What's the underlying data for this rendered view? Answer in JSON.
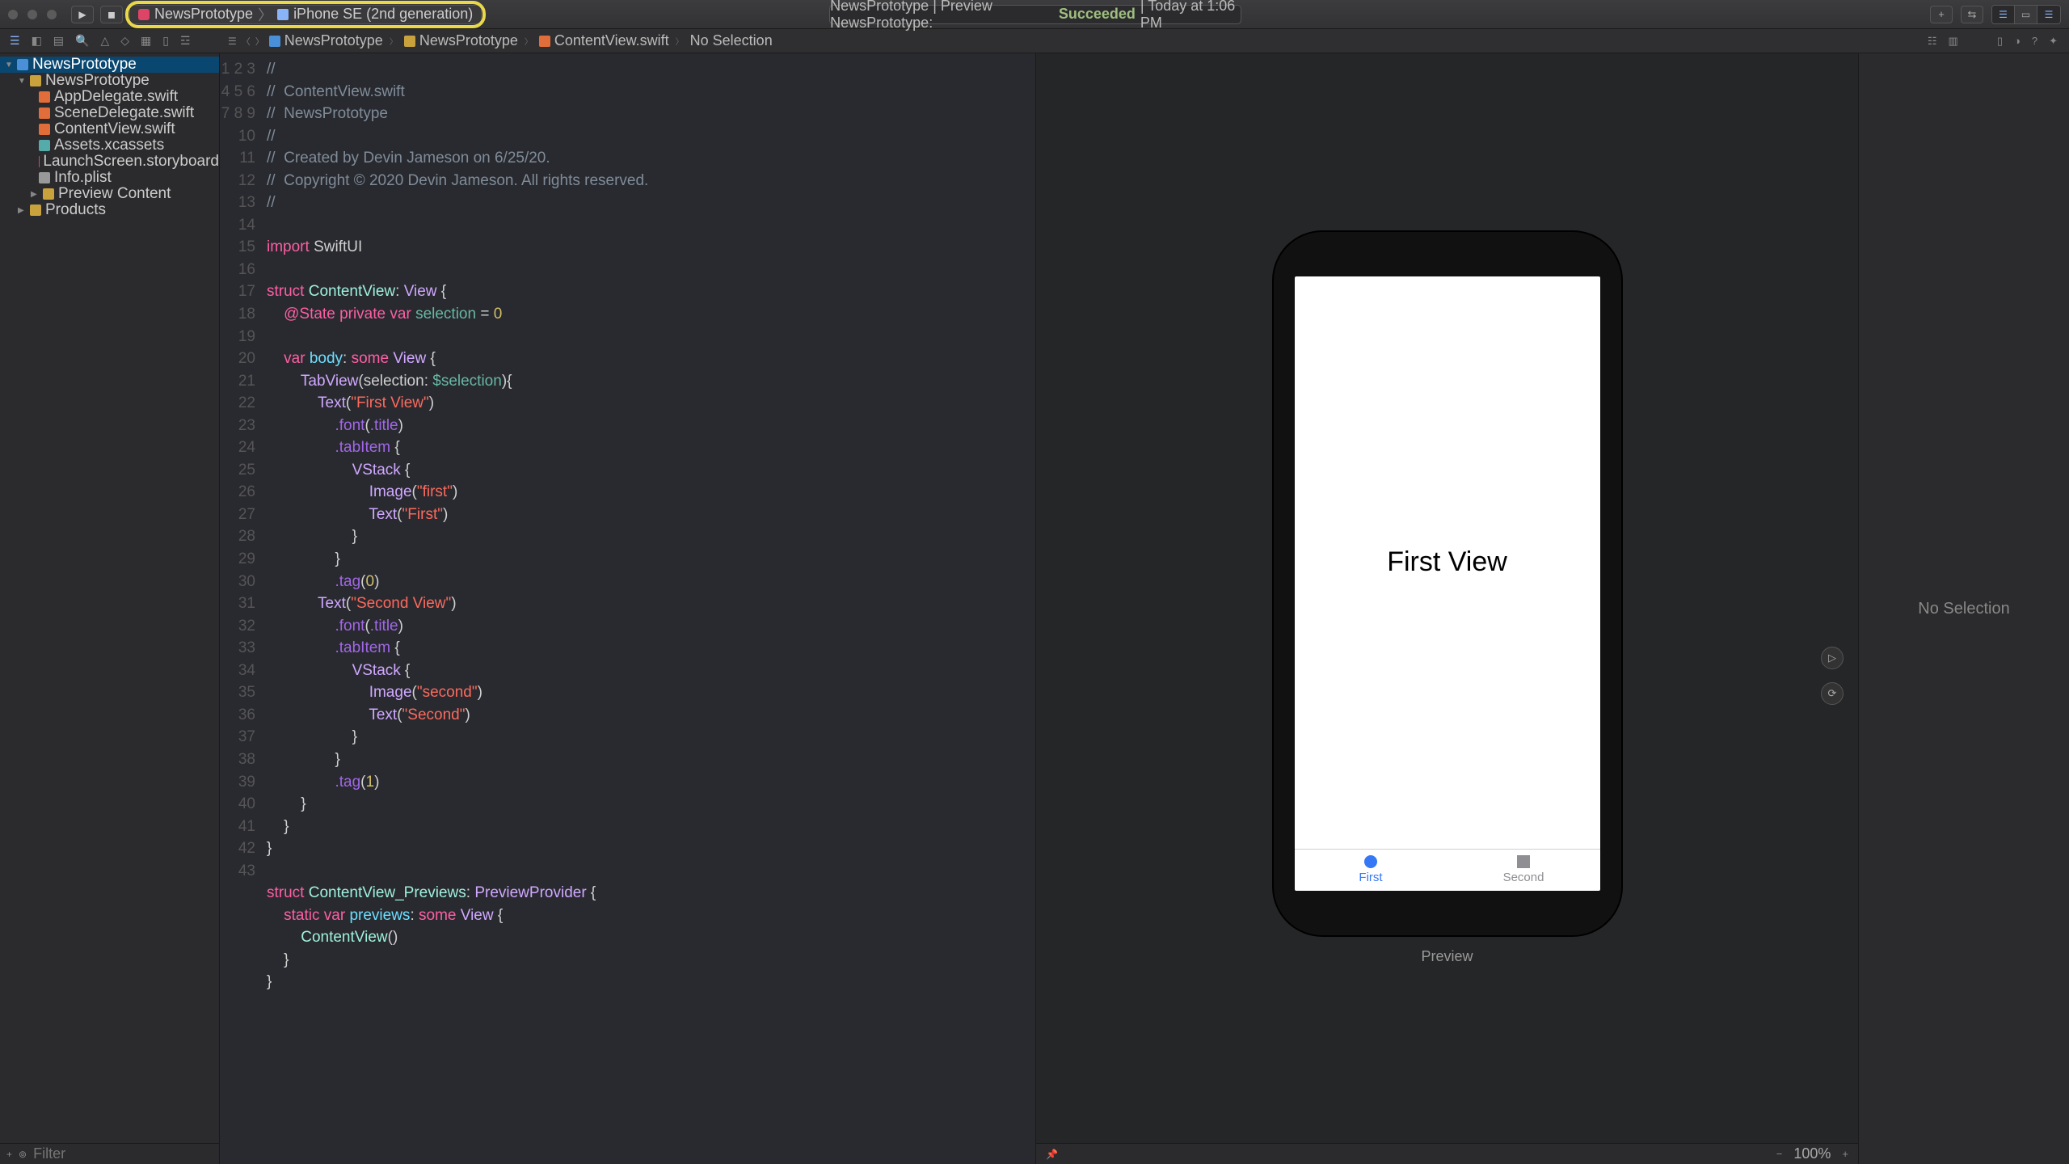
{
  "toolbar": {
    "scheme_app": "NewsPrototype",
    "scheme_device": "iPhone SE (2nd generation)",
    "activity_prefix": "NewsPrototype | Preview NewsPrototype:",
    "activity_status": "Succeeded",
    "activity_time": "| Today at 1:06 PM"
  },
  "breadcrumb": {
    "items": [
      "NewsPrototype",
      "NewsPrototype",
      "ContentView.swift",
      "No Selection"
    ]
  },
  "navigator": {
    "root": "NewsPrototype",
    "group": "NewsPrototype",
    "files": [
      "AppDelegate.swift",
      "SceneDelegate.swift",
      "ContentView.swift",
      "Assets.xcassets",
      "LaunchScreen.storyboard",
      "Info.plist"
    ],
    "preview_group": "Preview Content",
    "products": "Products",
    "filter_placeholder": "Filter"
  },
  "code": {
    "lines": 43,
    "l1": "//",
    "l2": "//  ContentView.swift",
    "l3": "//  NewsPrototype",
    "l4": "//",
    "l5": "//  Created by Devin Jameson on 6/25/20.",
    "l6": "//  Copyright © 2020 Devin Jameson. All rights reserved.",
    "l7": "//",
    "import_kw": "import",
    "import_mod": "SwiftUI",
    "struct_kw": "struct",
    "contentview": "ContentView",
    "view": "View",
    "state": "@State",
    "private": "private",
    "var": "var",
    "selection_id": "selection",
    "eq": " = ",
    "zero": "0",
    "body": "body",
    "some": "some",
    "tabview": "TabView",
    "sel_arg": "selection: ",
    "sel_bind": "$selection",
    "text": "Text",
    "first_view": "\"First View\"",
    "font": ".font",
    ".title": ".title",
    "tabitem": ".tabItem",
    "vstack": "VStack",
    "image": "Image",
    "first_img": "\"first\"",
    "first_txt": "\"First\"",
    "tag": ".tag",
    "tag0": "0",
    "tag1": "1",
    "second_view": "\"Second View\"",
    "second_img": "\"second\"",
    "second_txt": "\"Second\"",
    "previews_struct": "ContentView_Previews",
    "previewprovider": "PreviewProvider",
    "static": "static",
    "previews_var": "previews",
    "contentview_call": "ContentView"
  },
  "preview": {
    "main_text": "First View",
    "tab1": "First",
    "tab2": "Second",
    "label": "Preview",
    "zoom": "100%"
  },
  "inspector": {
    "empty": "No Selection"
  }
}
